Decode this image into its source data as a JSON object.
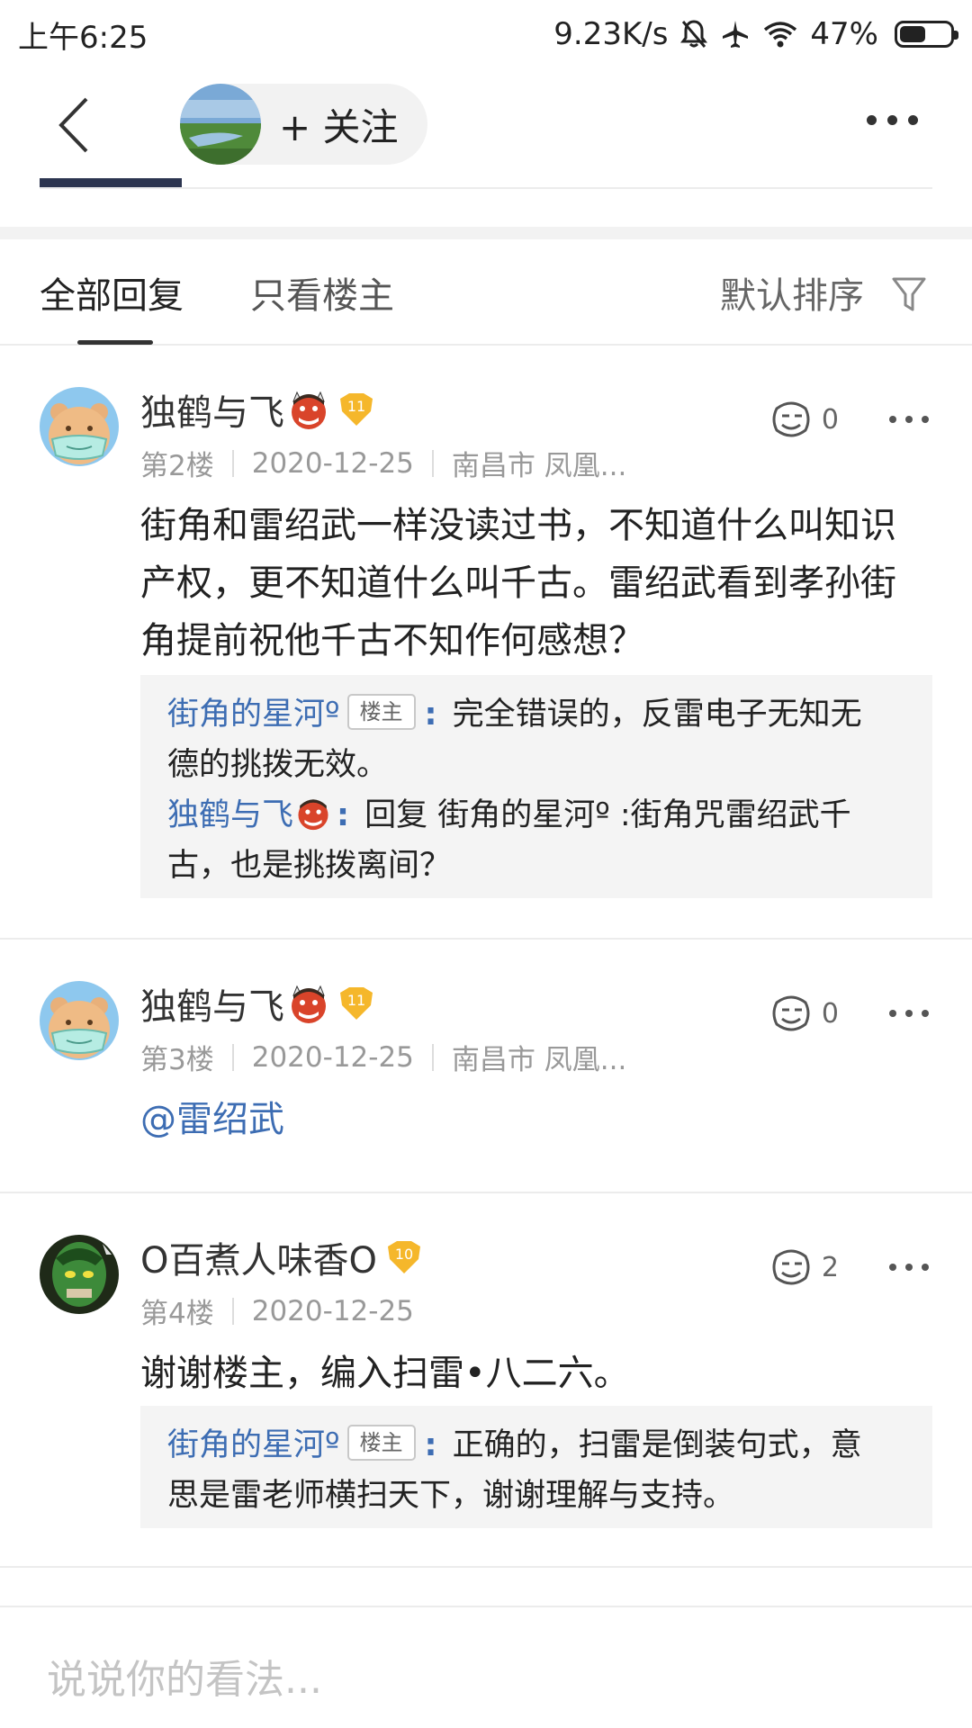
{
  "status_bar": {
    "time": "上午6:25",
    "net_speed": "9.23K/s",
    "battery": "47%",
    "battery_level": 0.47,
    "icons": [
      "mute-icon",
      "airplane-icon",
      "wifi-icon",
      "battery-icon"
    ]
  },
  "nav": {
    "follow_label": "+ 关注",
    "icons": [
      "back-icon",
      "more-icon"
    ]
  },
  "tabs": {
    "all_replies": "全部回复",
    "only_host": "只看楼主",
    "sort": "默认排序"
  },
  "comments": [
    {
      "name": "独鹤与飞",
      "level": "11",
      "floor": "第2楼",
      "date": "2020-12-25",
      "location": "南昌市 凤凰...",
      "likes": "0",
      "body": [
        "街角和雷绍武一样没读过书，不知道什么叫知识",
        "产权，更不知道什么叫千古。雷绍武看到孝孙街",
        "角提前祝他千古不知作何感想？"
      ],
      "replies": [
        {
          "name": "街角的星河º",
          "tag": "楼主",
          "colon": ":",
          "text": " 完全错误的，反雷电子无知无",
          "text2": "德的挑拨无效。"
        },
        {
          "name": "独鹤与飞",
          "colon": ":",
          "text": " 回复 街角的星河º :街角咒雷绍武千",
          "text2": "古，也是挑拨离间？"
        }
      ]
    },
    {
      "name": "独鹤与飞",
      "level": "11",
      "floor": "第3楼",
      "date": "2020-12-25",
      "location": "南昌市 凤凰...",
      "likes": "0",
      "body": "@雷绍武"
    },
    {
      "name": "O百煮人味香O",
      "level": "10",
      "floor": "第4楼",
      "date": "2020-12-25",
      "likes": "2",
      "body": "谢谢楼主，编入扫雷•八二六。",
      "replies": [
        {
          "name": "街角的星河º",
          "tag": "楼主",
          "colon": ":",
          "text": " 正确的，扫雷是倒装句式，意",
          "text2": "思是雷老师横扫天下，谢谢理解与支持。"
        }
      ]
    }
  ],
  "input": {
    "placeholder": "说说你的看法..."
  }
}
